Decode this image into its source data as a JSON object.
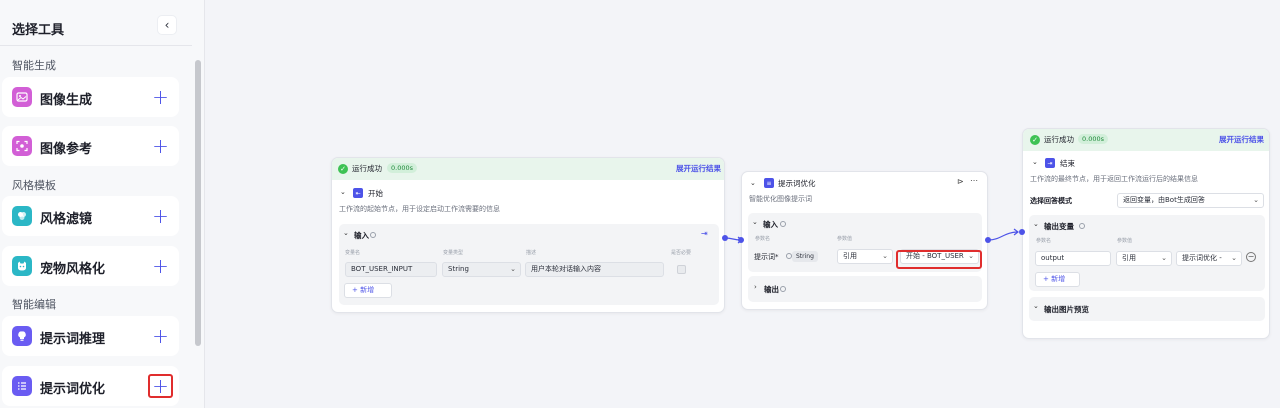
{
  "sidebar": {
    "title": "选择工具",
    "collapse_icon": "‹",
    "sections": [
      {
        "label": "智能生成"
      },
      {
        "label": "风格模板"
      },
      {
        "label": "智能编辑"
      }
    ],
    "tools": [
      {
        "label": "图像生成",
        "icon": "image-gen-icon",
        "color": "#d25fd6"
      },
      {
        "label": "图像参考",
        "icon": "image-ref-icon",
        "color": "#d25fd6"
      },
      {
        "label": "风格滤镜",
        "icon": "filter-icon",
        "color": "#2bb7c6"
      },
      {
        "label": "宠物风格化",
        "icon": "pet-icon",
        "color": "#2bb7c6"
      },
      {
        "label": "提示词推理",
        "icon": "bulb-icon",
        "color": "#6a5cf2"
      },
      {
        "label": "提示词优化",
        "icon": "list-icon",
        "color": "#6a5cf2"
      }
    ],
    "add_symbol": "+"
  },
  "start_node": {
    "run_status": "运行成功",
    "run_time": "0.000s",
    "run_link": "展开运行结果",
    "title": "开始",
    "description": "工作流的起始节点，用于设定启动工作流需要的信息",
    "input_title": "输入",
    "columns": {
      "name": "变量名",
      "type": "变量类型",
      "desc": "描述",
      "required": "是否必要"
    },
    "row": {
      "name": "BOT_USER_INPUT",
      "type": "String",
      "desc": "用户本轮对话输入内容"
    },
    "add_label": "+ 新增"
  },
  "prompt_node": {
    "title": "提示词优化",
    "description": "智能优化图像提示词",
    "input_title": "输入",
    "columns": {
      "name": "参数名",
      "value": "参数值"
    },
    "param_name": "提示词*",
    "param_type": "String",
    "ref_label": "引用",
    "ref_value": "开始 - BOT_USER",
    "output_title": "输出"
  },
  "end_node": {
    "run_status": "运行成功",
    "run_time": "0.000s",
    "run_link": "展开运行结果",
    "title": "结束",
    "description": "工作流的最终节点，用于返回工作流运行后的结果信息",
    "mode_label": "选择回答模式",
    "mode_value": "返回变量，由Bot生成回答",
    "output_title": "输出变量",
    "columns": {
      "name": "参数名",
      "value": "参数值"
    },
    "output_name": "output",
    "ref_label": "引用",
    "ref_value": "提示词优化 -",
    "add_label": "+ 新增",
    "preview_title": "输出图片预览"
  }
}
